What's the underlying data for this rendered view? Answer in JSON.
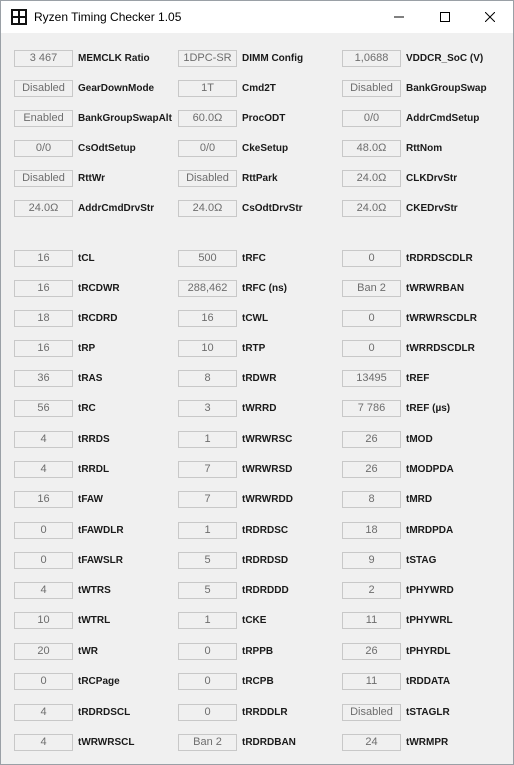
{
  "window": {
    "title": "Ryzen Timing Checker 1.05",
    "minimize_glyph": "minimize-icon",
    "maximize_glyph": "maximize-icon",
    "close_glyph": "close-icon"
  },
  "config": [
    [
      {
        "value": "3 467",
        "label": "MEMCLK Ratio"
      },
      {
        "value": "1DPC-SR",
        "label": "DIMM Config"
      },
      {
        "value": "1,0688",
        "label": "VDDCR_SoC (V)"
      }
    ],
    [
      {
        "value": "Disabled",
        "label": "GearDownMode"
      },
      {
        "value": "1T",
        "label": "Cmd2T"
      },
      {
        "value": "Disabled",
        "label": "BankGroupSwap"
      }
    ],
    [
      {
        "value": "Enabled",
        "label": "BankGroupSwapAlt"
      },
      {
        "value": "60.0Ω",
        "label": "ProcODT"
      },
      {
        "value": "0/0",
        "label": "AddrCmdSetup"
      }
    ],
    [
      {
        "value": "0/0",
        "label": "CsOdtSetup"
      },
      {
        "value": "0/0",
        "label": "CkeSetup"
      },
      {
        "value": "48.0Ω",
        "label": "RttNom"
      }
    ],
    [
      {
        "value": "Disabled",
        "label": "RttWr"
      },
      {
        "value": "Disabled",
        "label": "RttPark"
      },
      {
        "value": "24.0Ω",
        "label": "CLKDrvStr"
      }
    ],
    [
      {
        "value": "24.0Ω",
        "label": "AddrCmdDrvStr"
      },
      {
        "value": "24.0Ω",
        "label": "CsOdtDrvStr"
      },
      {
        "value": "24.0Ω",
        "label": "CKEDrvStr"
      }
    ]
  ],
  "timings": [
    [
      {
        "value": "16",
        "label": "tCL"
      },
      {
        "value": "500",
        "label": "tRFC"
      },
      {
        "value": "0",
        "label": "tRDRDSCDLR"
      }
    ],
    [
      {
        "value": "16",
        "label": "tRCDWR"
      },
      {
        "value": "288,462",
        "label": "tRFC (ns)"
      },
      {
        "value": "Ban 2",
        "label": "tWRWRBAN"
      }
    ],
    [
      {
        "value": "18",
        "label": "tRCDRD"
      },
      {
        "value": "16",
        "label": "tCWL"
      },
      {
        "value": "0",
        "label": "tWRWRSCDLR"
      }
    ],
    [
      {
        "value": "16",
        "label": "tRP"
      },
      {
        "value": "10",
        "label": "tRTP"
      },
      {
        "value": "0",
        "label": "tWRRDSCDLR"
      }
    ],
    [
      {
        "value": "36",
        "label": "tRAS"
      },
      {
        "value": "8",
        "label": "tRDWR"
      },
      {
        "value": "13495",
        "label": "tREF"
      }
    ],
    [
      {
        "value": "56",
        "label": "tRC"
      },
      {
        "value": "3",
        "label": "tWRRD"
      },
      {
        "value": "7 786",
        "label": "tREF (µs)"
      }
    ],
    [
      {
        "value": "4",
        "label": "tRRDS"
      },
      {
        "value": "1",
        "label": "tWRWRSC"
      },
      {
        "value": "26",
        "label": "tMOD"
      }
    ],
    [
      {
        "value": "4",
        "label": "tRRDL"
      },
      {
        "value": "7",
        "label": "tWRWRSD"
      },
      {
        "value": "26",
        "label": "tMODPDA"
      }
    ],
    [
      {
        "value": "16",
        "label": "tFAW"
      },
      {
        "value": "7",
        "label": "tWRWRDD"
      },
      {
        "value": "8",
        "label": "tMRD"
      }
    ],
    [
      {
        "value": "0",
        "label": "tFAWDLR"
      },
      {
        "value": "1",
        "label": "tRDRDSC"
      },
      {
        "value": "18",
        "label": "tMRDPDA"
      }
    ],
    [
      {
        "value": "0",
        "label": "tFAWSLR"
      },
      {
        "value": "5",
        "label": "tRDRDSD"
      },
      {
        "value": "9",
        "label": "tSTAG"
      }
    ],
    [
      {
        "value": "4",
        "label": "tWTRS"
      },
      {
        "value": "5",
        "label": "tRDRDDD"
      },
      {
        "value": "2",
        "label": "tPHYWRD"
      }
    ],
    [
      {
        "value": "10",
        "label": "tWTRL"
      },
      {
        "value": "1",
        "label": "tCKE"
      },
      {
        "value": "11",
        "label": "tPHYWRL"
      }
    ],
    [
      {
        "value": "20",
        "label": "tWR"
      },
      {
        "value": "0",
        "label": "tRPPB"
      },
      {
        "value": "26",
        "label": "tPHYRDL"
      }
    ],
    [
      {
        "value": "0",
        "label": "tRCPage"
      },
      {
        "value": "0",
        "label": "tRCPB"
      },
      {
        "value": "11",
        "label": "tRDDATA"
      }
    ],
    [
      {
        "value": "4",
        "label": "tRDRDSCL"
      },
      {
        "value": "0",
        "label": "tRRDDLR"
      },
      {
        "value": "Disabled",
        "label": "tSTAGLR"
      }
    ],
    [
      {
        "value": "4",
        "label": "tWRWRSCL"
      },
      {
        "value": "Ban 2",
        "label": "tRDRDBAN"
      },
      {
        "value": "24",
        "label": "tWRMPR"
      }
    ]
  ]
}
